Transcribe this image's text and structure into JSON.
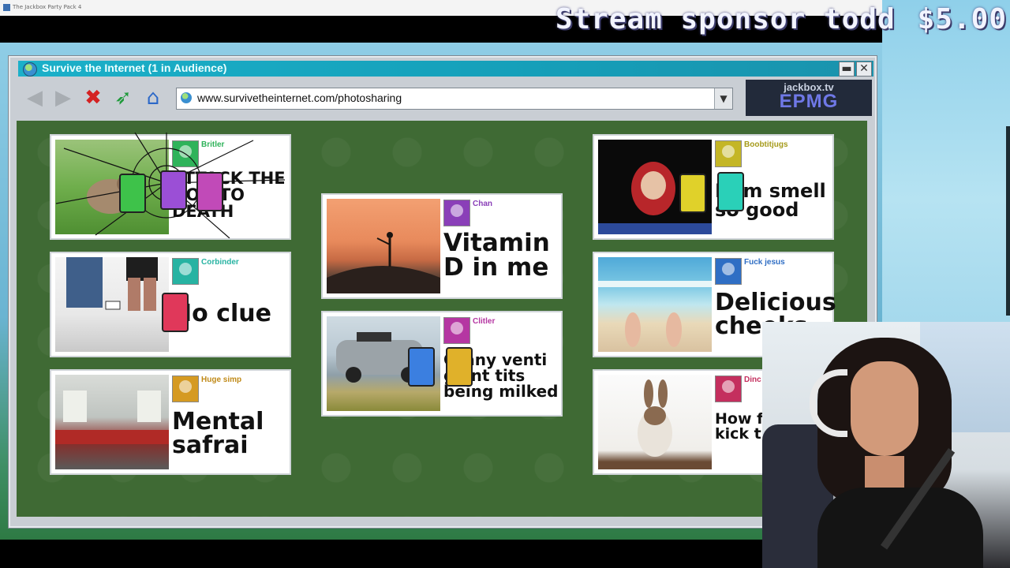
{
  "host": {
    "window_title": "The Jackbox Party Pack 4"
  },
  "sponsor": {
    "text": "Stream sponsor todd",
    "amount": "$5.00"
  },
  "browser": {
    "title": "Survive the Internet  (1 in Audience)",
    "minimize": "▬",
    "close": "✕",
    "url": "www.survivetheinternet.com/photosharing",
    "logo_small": "jackbox.tv",
    "logo_big": "EPMG"
  },
  "colors": {
    "content_bg": "#3f6a34",
    "titlebar": "#1bb0c9"
  },
  "cards": [
    {
      "username": "Britler",
      "caption": "ATTACK THE DOG TO DEATH",
      "avatar_color": "#2fb35a",
      "name_color": "#2fb35a"
    },
    {
      "username": "Corbinder",
      "caption": "No clue",
      "avatar_color": "#27b3a2",
      "name_color": "#27b3a2"
    },
    {
      "username": "Huge simp",
      "caption": "Mental safrai",
      "avatar_color": "#d59a22",
      "name_color": "#c08a18"
    },
    {
      "username": "Chan",
      "caption": "Vitamin D in me",
      "avatar_color": "#8a3fb8",
      "name_color": "#8a3fb8"
    },
    {
      "username": "Clitler",
      "caption": "Grany venti giant tits being milked",
      "avatar_color": "#b536a2",
      "name_color": "#b536a2"
    },
    {
      "username": "Boobtitjugs",
      "caption": "Bum smell so good",
      "avatar_color": "#c4b626",
      "name_color": "#a59a1a"
    },
    {
      "username": "Fuck jesus",
      "caption": "Delicious cheeks",
      "avatar_color": "#2f6ec4",
      "name_color": "#2f6ec4"
    },
    {
      "username": "Dinc",
      "caption": "How fa think I kick th",
      "avatar_color": "#c42f5e",
      "name_color": "#c42f5e"
    }
  ]
}
